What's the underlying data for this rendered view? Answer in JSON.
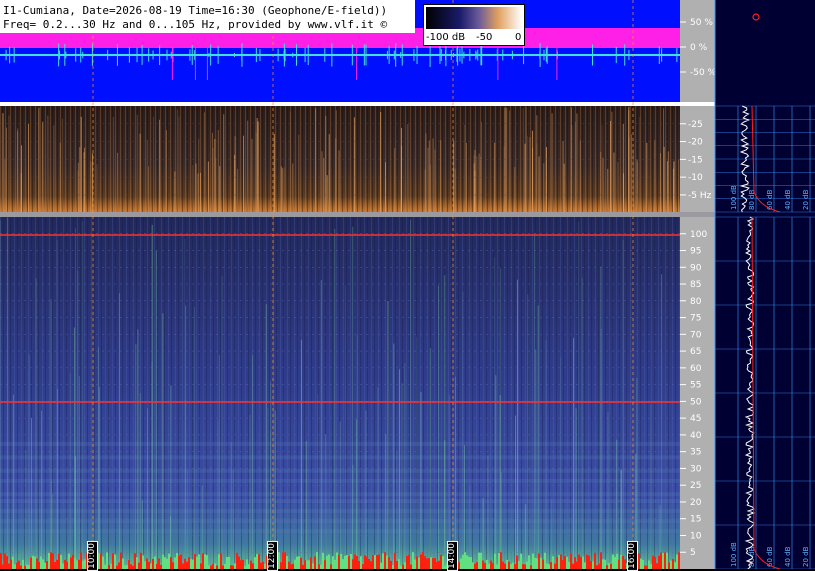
{
  "header": {
    "line1": "I1-Cumiana, Date=2026-08-19 Time=16:30 (Geophone/E-field))",
    "line2": "Freq= 0.2...30 Hz and 0...105 Hz, provided by www.vlf.it ©"
  },
  "scale": {
    "labels": [
      "-100 dB",
      "-50",
      "0"
    ]
  },
  "colors": {
    "bg_blue": "#0010ff",
    "magenta": "#ff20e8",
    "cyan": "#40e0e0",
    "spectro_dark": "#1a1a3a",
    "spectro_mid": "#3a4a9a",
    "panel_bg": "#000033",
    "grid": "#3a9aff",
    "red_line": "#ff2020",
    "orange": "#ff9a30"
  },
  "chart_data": [
    {
      "type": "line",
      "panel": "amplitude",
      "y_ticks": [
        "50 %",
        "0 %",
        "-50 %"
      ],
      "series": [
        {
          "color": "magenta"
        },
        {
          "color": "cyan"
        }
      ]
    },
    {
      "type": "heatmap",
      "panel": "low-frequency spectrogram",
      "y_ticks": [
        "25",
        "20",
        "15",
        "10",
        "5",
        "Hz"
      ],
      "ylim": [
        0.2,
        30
      ]
    },
    {
      "type": "heatmap",
      "panel": "main spectrogram",
      "y_ticks": [
        "100",
        "95",
        "90",
        "85",
        "80",
        "75",
        "70",
        "65",
        "60",
        "55",
        "50",
        "45",
        "40",
        "35",
        "30",
        "25",
        "20",
        "15",
        "10",
        "5"
      ],
      "ylim": [
        0,
        105
      ],
      "x_ticks": [
        "10:00",
        "12:00",
        "14:00",
        "16:00"
      ]
    },
    {
      "type": "line",
      "panel": "side spectrum upper",
      "x_ticks": [
        "100 dB",
        "80 dB",
        "60 dB",
        "40 dB",
        "20 dB"
      ]
    },
    {
      "type": "line",
      "panel": "side spectrum lower",
      "x_ticks": [
        "100 dB",
        "80 dB",
        "60 dB",
        "40 dB",
        "20 dB"
      ]
    }
  ]
}
